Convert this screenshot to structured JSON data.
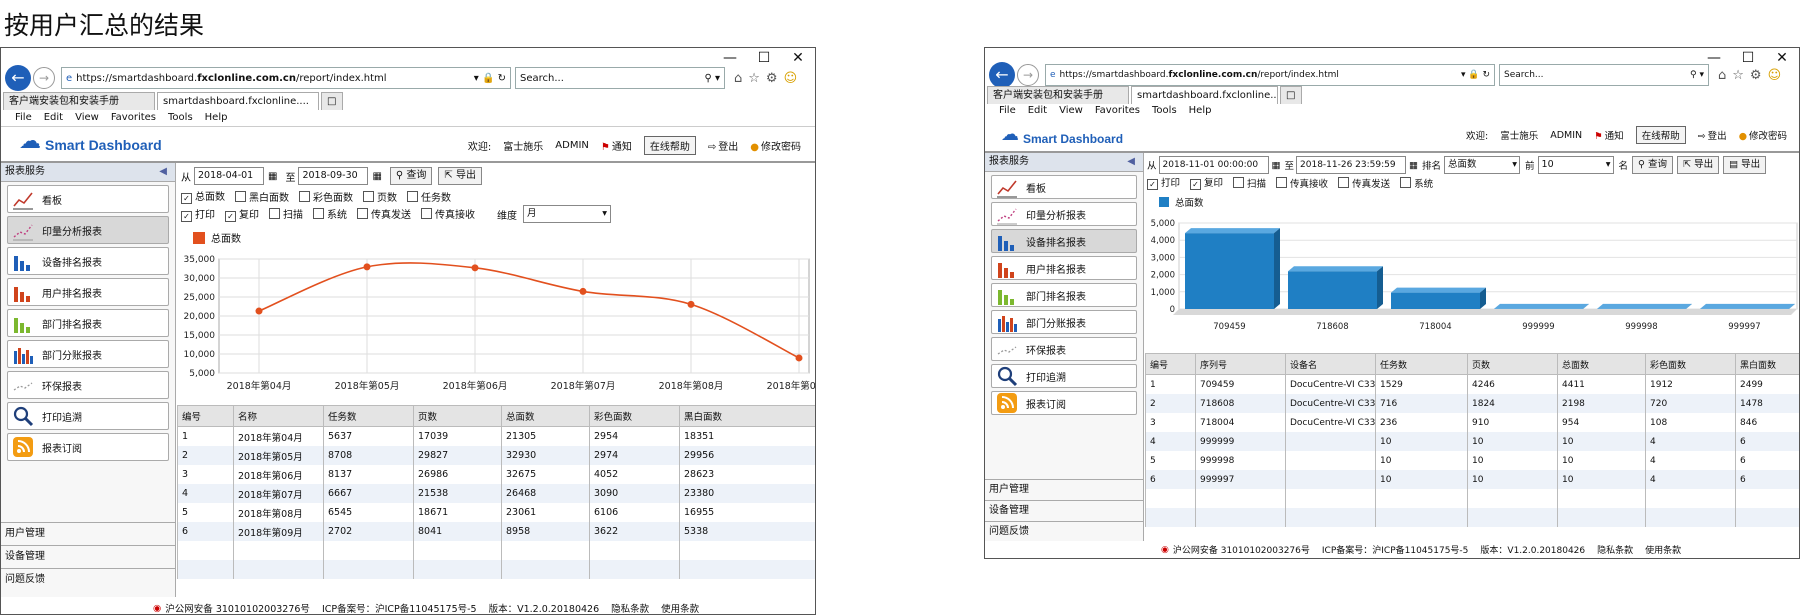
{
  "caption": "按用户汇总的结果",
  "browser": {
    "url_prefix": "https://smartdashboard.",
    "url_domain": "fxclonline.com.cn",
    "url_path": "/report/index.html",
    "search_placeholder": "Search...",
    "tab1": "客户端安装包和安装手册",
    "tab2": "smartdashboard.fxclonline....",
    "menu": [
      "File",
      "Edit",
      "View",
      "Favorites",
      "Tools",
      "Help"
    ],
    "window_controls": [
      "—",
      "☐",
      "✕"
    ]
  },
  "header": {
    "logo_text": "Smart Dashboard",
    "welcome": "欢迎:",
    "company": "富士施乐",
    "user": "ADMIN",
    "notify": "通知",
    "help": "在线帮助",
    "logout": "登出",
    "change_pw": "修改密码"
  },
  "sidebar": {
    "title": "报表服务",
    "items": [
      {
        "label": "看板",
        "icon": "line-chart-icon"
      },
      {
        "label": "印量分析报表",
        "icon": "dotted-line-chart-icon"
      },
      {
        "label": "设备排名报表",
        "icon": "blue-bar-chart-icon"
      },
      {
        "label": "用户排名报表",
        "icon": "red-bar-chart-icon"
      },
      {
        "label": "部门排名报表",
        "icon": "green-bar-chart-icon"
      },
      {
        "label": "部门分账报表",
        "icon": "multi-bar-chart-icon"
      },
      {
        "label": "环保报表",
        "icon": "eco-line-icon"
      },
      {
        "label": "打印追溯",
        "icon": "magnifier-icon"
      },
      {
        "label": "报表订阅",
        "icon": "rss-icon"
      }
    ],
    "bottom": [
      "用户管理",
      "设备管理",
      "问题反馈"
    ]
  },
  "left_panel": {
    "from_label": "从",
    "from_date": "2018-04-01",
    "to_label": "至",
    "to_date": "2018-09-30",
    "query": "查询",
    "export": "导出",
    "checks_row1": [
      {
        "label": "总面数",
        "checked": true
      },
      {
        "label": "黑白面数",
        "checked": false
      },
      {
        "label": "彩色面数",
        "checked": false
      },
      {
        "label": "页数",
        "checked": false
      },
      {
        "label": "任务数",
        "checked": false
      }
    ],
    "checks_row2": [
      {
        "label": "打印",
        "checked": true
      },
      {
        "label": "复印",
        "checked": true
      },
      {
        "label": "扫描",
        "checked": false
      },
      {
        "label": "系统",
        "checked": false
      },
      {
        "label": "传真发送",
        "checked": false
      },
      {
        "label": "传真接收",
        "checked": false
      }
    ],
    "dimension_label": "维度",
    "dimension_value": "月",
    "legend": "总面数",
    "legend_color": "#e2501e",
    "table": {
      "headers": [
        "编号",
        "名称",
        "任务数",
        "页数",
        "总面数",
        "彩色面数",
        "黑白面数"
      ],
      "rows": [
        [
          "1",
          "2018年第04月",
          "5637",
          "17039",
          "21305",
          "2954",
          "18351"
        ],
        [
          "2",
          "2018年第05月",
          "8708",
          "29827",
          "32930",
          "2974",
          "29956"
        ],
        [
          "3",
          "2018年第06月",
          "8137",
          "26986",
          "32675",
          "4052",
          "28623"
        ],
        [
          "4",
          "2018年第07月",
          "6667",
          "21538",
          "26468",
          "3090",
          "23380"
        ],
        [
          "5",
          "2018年第08月",
          "6545",
          "18671",
          "23061",
          "6106",
          "16955"
        ],
        [
          "6",
          "2018年第09月",
          "2702",
          "8041",
          "8958",
          "3622",
          "5338"
        ]
      ]
    }
  },
  "right_panel": {
    "from_label": "从",
    "from_date": "2018-11-01 00:00:00",
    "to_label": "至",
    "to_date": "2018-11-26 23:59:59",
    "rank_label": "排名",
    "rank_value": "总面数",
    "top_label": "前",
    "top_value": "10",
    "name_label": "名",
    "query": "查询",
    "export": "导出",
    "extra_btn": "导出",
    "checks": [
      {
        "label": "打印",
        "checked": true
      },
      {
        "label": "复印",
        "checked": true
      },
      {
        "label": "扫描",
        "checked": false
      },
      {
        "label": "传真接收",
        "checked": false
      },
      {
        "label": "传真发送",
        "checked": false
      },
      {
        "label": "系统",
        "checked": false
      }
    ],
    "legend": "总面数",
    "legend_color": "#1f7fc4",
    "table": {
      "headers": [
        "编号",
        "序列号",
        "设备名",
        "任务数",
        "页数",
        "总面数",
        "彩色面数",
        "黑白面数"
      ],
      "rows": [
        [
          "1",
          "709459",
          "DocuCentre-VI C3370",
          "1529",
          "4246",
          "4411",
          "1912",
          "2499"
        ],
        [
          "2",
          "718608",
          "DocuCentre-VI C3371",
          "716",
          "1824",
          "2198",
          "720",
          "1478"
        ],
        [
          "3",
          "718004",
          "DocuCentre-VI C3371",
          "236",
          "910",
          "954",
          "108",
          "846"
        ],
        [
          "4",
          "999999",
          "",
          "10",
          "10",
          "10",
          "4",
          "6"
        ],
        [
          "5",
          "999998",
          "",
          "10",
          "10",
          "10",
          "4",
          "6"
        ],
        [
          "6",
          "999997",
          "",
          "10",
          "10",
          "10",
          "4",
          "6"
        ]
      ]
    }
  },
  "footer": {
    "police": "沪公网安备 31010102003276号",
    "icp": "ICP备案号：沪ICP备11045175号-5",
    "version": "版本：V1.2.0.20180426",
    "privacy": "隐私条款",
    "terms": "使用条款"
  },
  "chart_data": [
    {
      "type": "line",
      "categories": [
        "2018年第04月",
        "2018年第05月",
        "2018年第06月",
        "2018年第07月",
        "2018年第08月",
        "2018年第09月"
      ],
      "series": [
        {
          "name": "总面数",
          "values": [
            21305,
            32930,
            32675,
            26468,
            23061,
            8958
          ]
        }
      ],
      "yticks": [
        "5,000",
        "10,000",
        "15,000",
        "20,000",
        "25,000",
        "30,000",
        "35,000"
      ],
      "ylim": [
        5000,
        35000
      ],
      "grid": true,
      "color": "#e2501e"
    },
    {
      "type": "bar",
      "categories": [
        "709459",
        "718608",
        "718004",
        "999999",
        "999998",
        "999997"
      ],
      "series": [
        {
          "name": "总面数",
          "values": [
            4411,
            2198,
            954,
            10,
            10,
            10
          ]
        }
      ],
      "yticks": [
        "0",
        "1,000",
        "2,000",
        "3,000",
        "4,000",
        "5,000"
      ],
      "ylim": [
        0,
        5000
      ],
      "grid": true,
      "color": "#1f7fc4"
    }
  ]
}
